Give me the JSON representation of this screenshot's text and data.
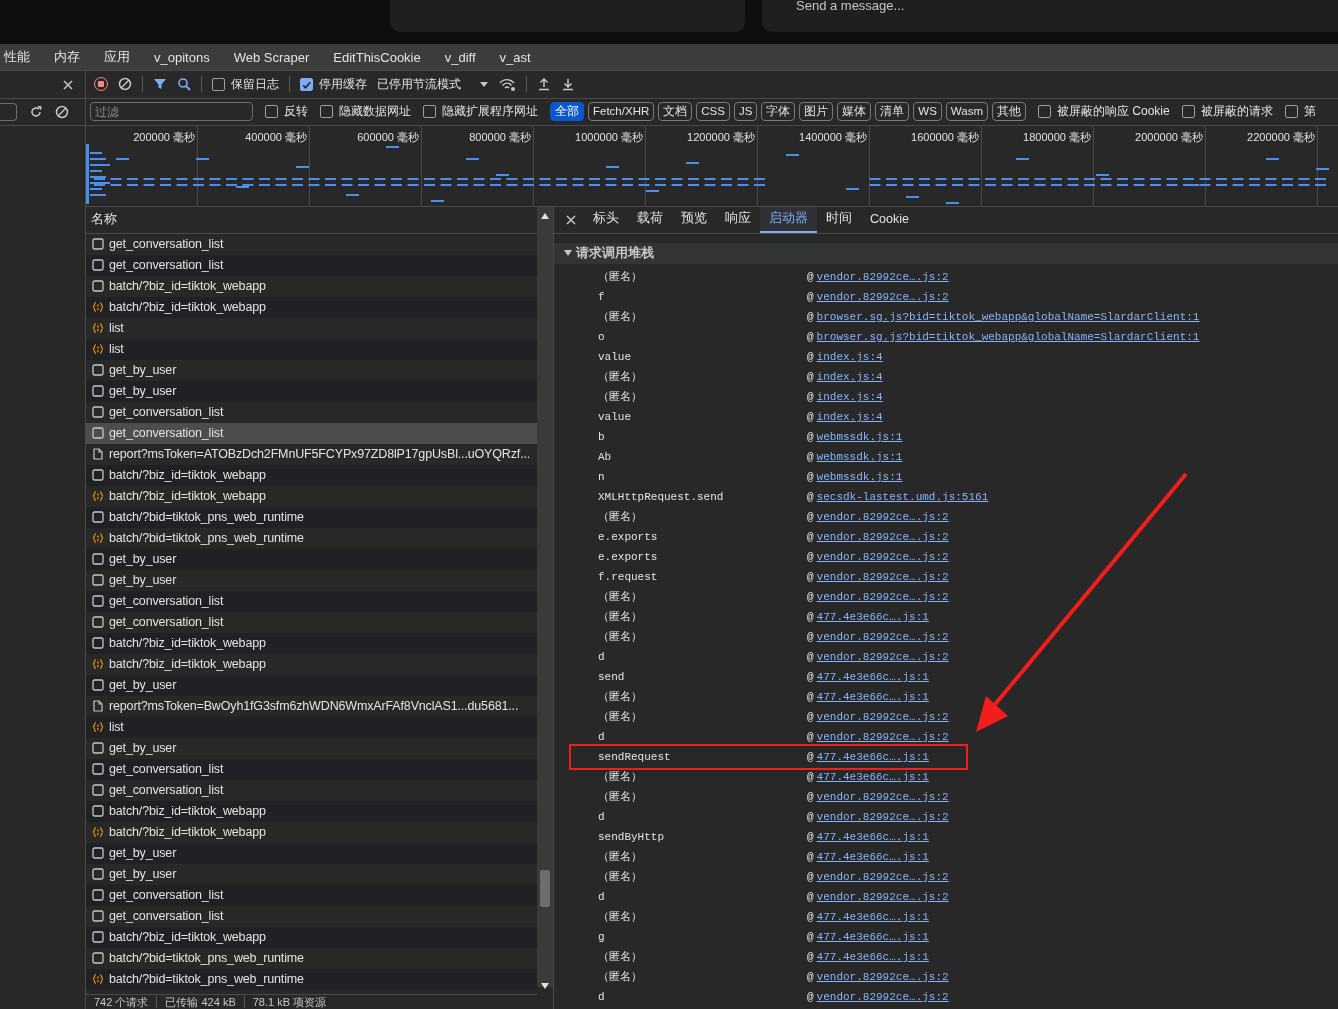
{
  "chat": {
    "placeholder": "Send a message..."
  },
  "panel_tabs": [
    {
      "label": "性能"
    },
    {
      "label": "内存"
    },
    {
      "label": "应用"
    },
    {
      "label": "v_opitons"
    },
    {
      "label": "Web Scraper"
    },
    {
      "label": "EditThisCookie"
    },
    {
      "label": "v_diff"
    },
    {
      "label": "v_ast"
    }
  ],
  "toolbar": {
    "recording": true,
    "preserve_log": {
      "label": "保留日志",
      "checked": false
    },
    "disable_cache": {
      "label": "停用缓存",
      "checked": true
    },
    "throttling": "已停用节流模式"
  },
  "filter": {
    "placeholder": "过滤",
    "options": [
      {
        "label": "反转",
        "checked": false
      },
      {
        "label": "隐藏数据网址",
        "checked": false
      },
      {
        "label": "隐藏扩展程序网址",
        "checked": false
      }
    ],
    "types": [
      {
        "label": "全部",
        "selected": true
      },
      {
        "label": "Fetch/XHR",
        "selected": false
      },
      {
        "label": "文档",
        "selected": false
      },
      {
        "label": "CSS",
        "selected": false
      },
      {
        "label": "JS",
        "selected": false
      },
      {
        "label": "字体",
        "selected": false
      },
      {
        "label": "图片",
        "selected": false
      },
      {
        "label": "媒体",
        "selected": false
      },
      {
        "label": "清单",
        "selected": false
      },
      {
        "label": "WS",
        "selected": false
      },
      {
        "label": "Wasm",
        "selected": false
      },
      {
        "label": "其他",
        "selected": false
      }
    ],
    "more_options": [
      {
        "label": "被屏蔽的响应 Cookie",
        "checked": false
      },
      {
        "label": "被屏蔽的请求",
        "checked": false
      },
      {
        "label": "第",
        "checked": false
      }
    ]
  },
  "timeline": {
    "ticks": [
      "200000 毫秒",
      "400000 毫秒",
      "600000 毫秒",
      "800000 毫秒",
      "1000000 毫秒",
      "1200000 毫秒",
      "1400000 毫秒",
      "1600000 毫秒",
      "1800000 毫秒",
      "2000000 毫秒",
      "2200000 毫秒"
    ]
  },
  "requests": {
    "header": "名称",
    "rows": [
      {
        "name": "get_conversation_list",
        "kind": "fetch",
        "selected": false
      },
      {
        "name": "get_conversation_list",
        "kind": "fetch",
        "selected": false
      },
      {
        "name": "batch/?biz_id=tiktok_webapp",
        "kind": "fetch",
        "selected": false
      },
      {
        "name": "batch/?biz_id=tiktok_webapp",
        "kind": "script",
        "selected": false
      },
      {
        "name": "list",
        "kind": "script",
        "selected": false
      },
      {
        "name": "list",
        "kind": "script",
        "selected": false
      },
      {
        "name": "get_by_user",
        "kind": "fetch",
        "selected": false
      },
      {
        "name": "get_by_user",
        "kind": "fetch",
        "selected": false
      },
      {
        "name": "get_conversation_list",
        "kind": "fetch",
        "selected": false
      },
      {
        "name": "get_conversation_list",
        "kind": "fetch",
        "selected": true
      },
      {
        "name": "report?msToken=ATOBzDch2FMnUF5FCYPx97ZD8lP17gpUsBl...uOYQRzf...",
        "kind": "document",
        "selected": false
      },
      {
        "name": "batch/?biz_id=tiktok_webapp",
        "kind": "fetch",
        "selected": false
      },
      {
        "name": "batch/?biz_id=tiktok_webapp",
        "kind": "script",
        "selected": false
      },
      {
        "name": "batch/?bid=tiktok_pns_web_runtime",
        "kind": "fetch",
        "selected": false
      },
      {
        "name": "batch/?bid=tiktok_pns_web_runtime",
        "kind": "script",
        "selected": false
      },
      {
        "name": "get_by_user",
        "kind": "fetch",
        "selected": false
      },
      {
        "name": "get_by_user",
        "kind": "fetch",
        "selected": false
      },
      {
        "name": "get_conversation_list",
        "kind": "fetch",
        "selected": false
      },
      {
        "name": "get_conversation_list",
        "kind": "fetch",
        "selected": false
      },
      {
        "name": "batch/?biz_id=tiktok_webapp",
        "kind": "fetch",
        "selected": false
      },
      {
        "name": "batch/?biz_id=tiktok_webapp",
        "kind": "script",
        "selected": false
      },
      {
        "name": "get_by_user",
        "kind": "fetch",
        "selected": false
      },
      {
        "name": "report?msToken=BwOyh1fG3sfm6zhWDN6WmxArFAf8VnclAS1...du5681...",
        "kind": "document",
        "selected": false
      },
      {
        "name": "list",
        "kind": "script",
        "selected": false
      },
      {
        "name": "get_by_user",
        "kind": "fetch",
        "selected": false
      },
      {
        "name": "get_conversation_list",
        "kind": "fetch",
        "selected": false
      },
      {
        "name": "get_conversation_list",
        "kind": "fetch",
        "selected": false
      },
      {
        "name": "batch/?biz_id=tiktok_webapp",
        "kind": "fetch",
        "selected": false
      },
      {
        "name": "batch/?biz_id=tiktok_webapp",
        "kind": "script",
        "selected": false
      },
      {
        "name": "get_by_user",
        "kind": "fetch",
        "selected": false
      },
      {
        "name": "get_by_user",
        "kind": "fetch",
        "selected": false
      },
      {
        "name": "get_conversation_list",
        "kind": "fetch",
        "selected": false
      },
      {
        "name": "get_conversation_list",
        "kind": "fetch",
        "selected": false
      },
      {
        "name": "batch/?biz_id=tiktok_webapp",
        "kind": "fetch",
        "selected": false
      },
      {
        "name": "batch/?bid=tiktok_pns_web_runtime",
        "kind": "fetch",
        "selected": false
      },
      {
        "name": "batch/?bid=tiktok_pns_web_runtime",
        "kind": "script",
        "selected": false
      }
    ]
  },
  "details": {
    "tabs": [
      {
        "label": "标头",
        "selected": false
      },
      {
        "label": "载荷",
        "selected": false
      },
      {
        "label": "预览",
        "selected": false
      },
      {
        "label": "响应",
        "selected": false
      },
      {
        "label": "启动器",
        "selected": true
      },
      {
        "label": "时间",
        "selected": false
      },
      {
        "label": "Cookie",
        "selected": false
      }
    ],
    "section": {
      "title": "请求调用堆栈",
      "expanded": true
    },
    "stack": [
      {
        "function": "（匿名）",
        "marker": "@",
        "location": "vendor.82992ce….js:2",
        "highlighted": false
      },
      {
        "function": "f",
        "marker": "@",
        "location": "vendor.82992ce….js:2",
        "highlighted": false
      },
      {
        "function": "（匿名）",
        "marker": "@",
        "location": "browser.sg.js?bid=tiktok_webapp&globalName=SlardarClient:1",
        "highlighted": false
      },
      {
        "function": "o",
        "marker": "@",
        "location": "browser.sg.js?bid=tiktok_webapp&globalName=SlardarClient:1",
        "highlighted": false
      },
      {
        "function": "value",
        "marker": "@",
        "location": "index.js:4",
        "highlighted": false
      },
      {
        "function": "（匿名）",
        "marker": "@",
        "location": "index.js:4",
        "highlighted": false
      },
      {
        "function": "（匿名）",
        "marker": "@",
        "location": "index.js:4",
        "highlighted": false
      },
      {
        "function": "value",
        "marker": "@",
        "location": "index.js:4",
        "highlighted": false
      },
      {
        "function": "b",
        "marker": "@",
        "location": "webmssdk.js:1",
        "highlighted": false
      },
      {
        "function": "Ab",
        "marker": "@",
        "location": "webmssdk.js:1",
        "highlighted": false
      },
      {
        "function": "n",
        "marker": "@",
        "location": "webmssdk.js:1",
        "highlighted": false
      },
      {
        "function": "XMLHttpRequest.send",
        "marker": "@",
        "location": "secsdk-lastest.umd.js:5161",
        "highlighted": false
      },
      {
        "function": "（匿名）",
        "marker": "@",
        "location": "vendor.82992ce….js:2",
        "highlighted": false
      },
      {
        "function": "e.exports",
        "marker": "@",
        "location": "vendor.82992ce….js:2",
        "highlighted": false
      },
      {
        "function": "e.exports",
        "marker": "@",
        "location": "vendor.82992ce….js:2",
        "highlighted": false
      },
      {
        "function": "f.request",
        "marker": "@",
        "location": "vendor.82992ce….js:2",
        "highlighted": false
      },
      {
        "function": "（匿名）",
        "marker": "@",
        "location": "vendor.82992ce….js:2",
        "highlighted": false
      },
      {
        "function": "（匿名）",
        "marker": "@",
        "location": "477.4e3e66c….js:1",
        "highlighted": false
      },
      {
        "function": "（匿名）",
        "marker": "@",
        "location": "vendor.82992ce….js:2",
        "highlighted": false
      },
      {
        "function": "d",
        "marker": "@",
        "location": "vendor.82992ce….js:2",
        "highlighted": false
      },
      {
        "function": "send",
        "marker": "@",
        "location": "477.4e3e66c….js:1",
        "highlighted": false
      },
      {
        "function": "（匿名）",
        "marker": "@",
        "location": "477.4e3e66c….js:1",
        "highlighted": false
      },
      {
        "function": "（匿名）",
        "marker": "@",
        "location": "vendor.82992ce….js:2",
        "highlighted": false
      },
      {
        "function": "d",
        "marker": "@",
        "location": "vendor.82992ce….js:2",
        "highlighted": false
      },
      {
        "function": "sendRequest",
        "marker": "@",
        "location": "477.4e3e66c….js:1",
        "highlighted": true
      },
      {
        "function": "（匿名）",
        "marker": "@",
        "location": "477.4e3e66c….js:1",
        "highlighted": false
      },
      {
        "function": "（匿名）",
        "marker": "@",
        "location": "vendor.82992ce….js:2",
        "highlighted": false
      },
      {
        "function": "d",
        "marker": "@",
        "location": "vendor.82992ce….js:2",
        "highlighted": false
      },
      {
        "function": "sendByHttp",
        "marker": "@",
        "location": "477.4e3e66c….js:1",
        "highlighted": false
      },
      {
        "function": "（匿名）",
        "marker": "@",
        "location": "477.4e3e66c….js:1",
        "highlighted": false
      },
      {
        "function": "（匿名）",
        "marker": "@",
        "location": "vendor.82992ce….js:2",
        "highlighted": false
      },
      {
        "function": "d",
        "marker": "@",
        "location": "vendor.82992ce….js:2",
        "highlighted": false
      },
      {
        "function": "（匿名）",
        "marker": "@",
        "location": "477.4e3e66c….js:1",
        "highlighted": false
      },
      {
        "function": "g",
        "marker": "@",
        "location": "477.4e3e66c….js:1",
        "highlighted": false
      },
      {
        "function": "（匿名）",
        "marker": "@",
        "location": "477.4e3e66c….js:1",
        "highlighted": false
      },
      {
        "function": "（匿名）",
        "marker": "@",
        "location": "vendor.82992ce….js:2",
        "highlighted": false
      },
      {
        "function": "d",
        "marker": "@",
        "location": "vendor.82992ce….js:2",
        "highlighted": false
      }
    ]
  },
  "status_bar": [
    "742 个请求",
    "已传输 424 kB",
    "78.1 kB 项资源"
  ]
}
